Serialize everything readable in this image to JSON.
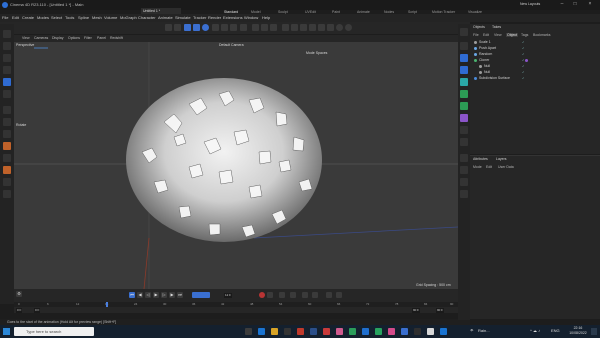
{
  "window": {
    "title": "Cinema 4D R23.110 - [Untitled 1 *] - Main",
    "new_layouts": "New Layouts"
  },
  "menu": [
    "File",
    "Edit",
    "Create",
    "Modes",
    "Select",
    "Tools",
    "Spline",
    "Mesh",
    "Volume",
    "MoGraph",
    "Character",
    "Animate",
    "Simulate",
    "Tracker",
    "Render",
    "Extensions",
    "Window",
    "Help"
  ],
  "document_tab": "Untitled 1 *",
  "layout_tabs": [
    "Standard",
    "Model",
    "Sculpt",
    "UVEdit",
    "Paint",
    "Animate",
    "Nodes",
    "Script",
    "Motion Tracker",
    "Visualize"
  ],
  "viewport": {
    "menu": [
      "View",
      "Cameras",
      "Display",
      "Options",
      "Filter",
      "Panel",
      "Redshift"
    ],
    "perspective_label": "Perspective",
    "camera_label": "Default Camera",
    "mode_label": "Mode Spaces",
    "rotate_label": "Rotate",
    "grid_spacing": "Grid Spacing : 500 cm"
  },
  "timeline": {
    "ticks": [
      "0",
      "6",
      "12",
      "18",
      "24",
      "30",
      "36",
      "42",
      "48",
      "54",
      "60",
      "66",
      "72",
      "78",
      "84",
      "90"
    ],
    "current_frame": "12 F",
    "start_frame": "0 F",
    "start_field": "0 F",
    "end_field": "90 F",
    "end_field_2": "90 F",
    "zero_label": "0"
  },
  "status": {
    "text": "Goes to the start of the animation (Hold Alt for preview range) [Shift+F]"
  },
  "objects_panel": {
    "tabs": [
      "Objects",
      "Takes"
    ],
    "menu": [
      "File",
      "Edit",
      "View",
      "Object",
      "Tags",
      "Bookmarks"
    ],
    "active_menu": "Object",
    "items": [
      {
        "name": "Scale 1"
      },
      {
        "name": "Push Apart"
      },
      {
        "name": "Random"
      },
      {
        "name": "Cloner"
      },
      {
        "name": "Null"
      },
      {
        "name": "Null"
      },
      {
        "name": "Subdivision Surface"
      }
    ]
  },
  "attributes_panel": {
    "tabs": [
      "Attributes",
      "Layers"
    ],
    "menu": [
      "Mode",
      "Edit",
      "User Data"
    ]
  },
  "taskbar": {
    "search_placeholder": "Type here to search",
    "weather": "Rain...",
    "language": "ENG",
    "time": "22:16",
    "date": "10/08/2022"
  },
  "colors": {
    "accent_blue": "#2f6bd2",
    "viewport_bg": "#3a3a3a",
    "record_red": "#b83434"
  }
}
